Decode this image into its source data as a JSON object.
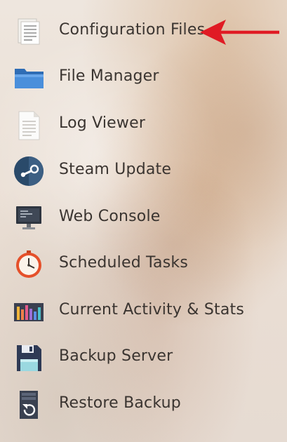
{
  "menu": {
    "items": [
      {
        "label": "Configuration Files",
        "icon": "document-icon"
      },
      {
        "label": "File Manager",
        "icon": "folder-icon"
      },
      {
        "label": "Log Viewer",
        "icon": "log-file-icon"
      },
      {
        "label": "Steam Update",
        "icon": "steam-icon"
      },
      {
        "label": "Web Console",
        "icon": "console-monitor-icon"
      },
      {
        "label": "Scheduled Tasks",
        "icon": "clock-icon"
      },
      {
        "label": "Current Activity & Stats",
        "icon": "bar-chart-icon"
      },
      {
        "label": "Backup Server",
        "icon": "floppy-disk-icon"
      },
      {
        "label": "Restore Backup",
        "icon": "restore-icon"
      }
    ]
  },
  "annotation": {
    "arrow_color": "#e01b24",
    "points_to": "Configuration Files"
  },
  "colors": {
    "text": "#3a3430",
    "folder": "#3d7fd0",
    "steam": "#2a4a6a",
    "clock": "#e5502a",
    "floppy": "#2e3a55"
  }
}
